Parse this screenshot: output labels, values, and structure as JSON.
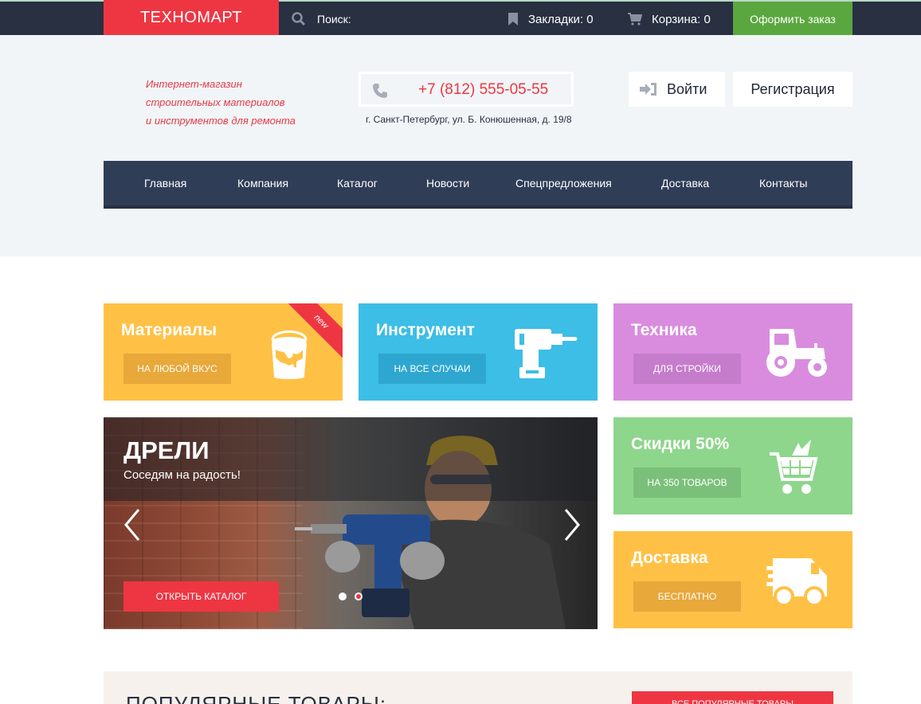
{
  "topbar": {
    "logo": "ТЕХНОМАРТ",
    "search_label": "Поиск:",
    "bookmarks": "Закладки: 0",
    "cart": "Корзина: 0",
    "order_button": "Оформить заказ"
  },
  "header": {
    "tagline": [
      "Интернет-магазин",
      "строительных материалов",
      "и инструментов для ремонта"
    ],
    "phone": "+7 (812) 555-05-55",
    "address": "г. Санкт-Петербург, ул. Б. Конюшенная, д. 19/8",
    "login": "Войти",
    "register": "Регистрация"
  },
  "nav": [
    "Главная",
    "Компания",
    "Каталог",
    "Новости",
    "Спецпредложения",
    "Доставка",
    "Контакты"
  ],
  "tiles": {
    "materials": {
      "title": "Материалы",
      "button": "НА ЛЮБОЙ ВКУС",
      "ribbon": "new",
      "color": "#ffc145"
    },
    "tools": {
      "title": "Инструмент",
      "button": "НА ВСЕ СЛУЧАИ",
      "color": "#3cbee6"
    },
    "machinery": {
      "title": "Техника",
      "button": "ДЛЯ СТРОЙКИ",
      "color": "#d98cde"
    },
    "discount": {
      "title": "Скидки 50%",
      "button": "НА 350 ТОВАРОВ",
      "color": "#8dd68b"
    },
    "delivery": {
      "title": "Доставка",
      "button": "БЕСПЛАТНО",
      "color": "#ffc145"
    }
  },
  "slider": {
    "title": "ДРЕЛИ",
    "subtitle": "Соседям на радость!",
    "button": "ОТКРЫТЬ КАТАЛОГ",
    "slides": 2,
    "active_slide": 2
  },
  "popular": {
    "title": "ПОПУЛЯРНЫЕ ТОВАРЫ:",
    "button": "ВСЕ ПОПУЛЯРНЫЕ ТОВАРЫ"
  },
  "icons": [
    "search-icon",
    "bookmark-icon",
    "cart-icon",
    "phone-icon",
    "login-icon",
    "paint-bucket-icon",
    "drill-icon",
    "tractor-icon",
    "discount-cart-icon",
    "delivery-truck-icon",
    "arrow-left-icon",
    "arrow-right-icon"
  ]
}
